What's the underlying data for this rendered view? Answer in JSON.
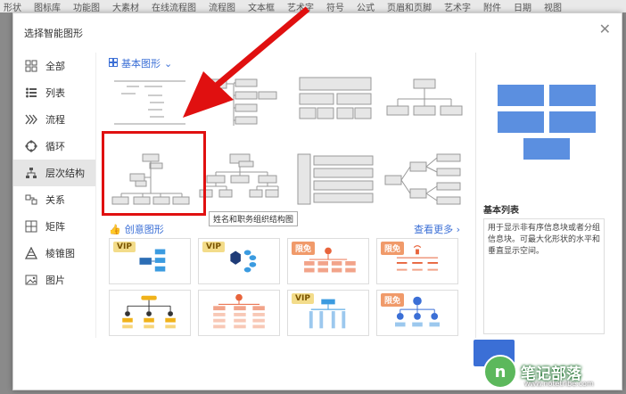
{
  "toolbar": {
    "items": [
      "形状",
      "图标库",
      "功能图",
      "大素材",
      "在线流程图",
      "流程图",
      "文本框",
      "艺术字",
      "符号",
      "公式",
      "页眉和页脚",
      "艺术字",
      "附件",
      "日期",
      "视图"
    ]
  },
  "dialog": {
    "title": "选择智能图形",
    "close_icon": "close-icon"
  },
  "sidebar": {
    "items": [
      {
        "label": "全部",
        "icon": "grid-icon"
      },
      {
        "label": "列表",
        "icon": "list-icon"
      },
      {
        "label": "流程",
        "icon": "chevrons-icon"
      },
      {
        "label": "循环",
        "icon": "cycle-icon"
      },
      {
        "label": "层次结构",
        "icon": "hierarchy-icon",
        "active": true
      },
      {
        "label": "关系",
        "icon": "relation-icon"
      },
      {
        "label": "矩阵",
        "icon": "matrix-icon"
      },
      {
        "label": "棱锥图",
        "icon": "pyramid-icon"
      },
      {
        "label": "图片",
        "icon": "picture-icon"
      }
    ]
  },
  "main": {
    "basic_header": "基本图形",
    "tooltip": "姓名和职务组织结构图",
    "creative_header": "创意图形",
    "see_more": "查看更多"
  },
  "creative_cards": [
    {
      "badge": "VIP",
      "badge_type": "vip"
    },
    {
      "badge": "VIP",
      "badge_type": "vip"
    },
    {
      "badge": "限免",
      "badge_type": "free"
    },
    {
      "badge": "限免",
      "badge_type": "free"
    },
    {
      "badge": "",
      "badge_type": ""
    },
    {
      "badge": "",
      "badge_type": ""
    },
    {
      "badge": "VIP",
      "badge_type": "vip"
    },
    {
      "badge": "限免",
      "badge_type": "free"
    }
  ],
  "preview": {
    "title": "基本列表",
    "description": "用于显示非有序信息块或者分组信息块。可最大化形状的水平和垂直显示空间。"
  },
  "watermark": {
    "logo": "n",
    "text": "笔记部落",
    "url": "www.notetribe.com"
  },
  "colors": {
    "accent": "#3b6fd6",
    "highlight": "#e01010",
    "preview_blue": "#5b8fe0"
  }
}
